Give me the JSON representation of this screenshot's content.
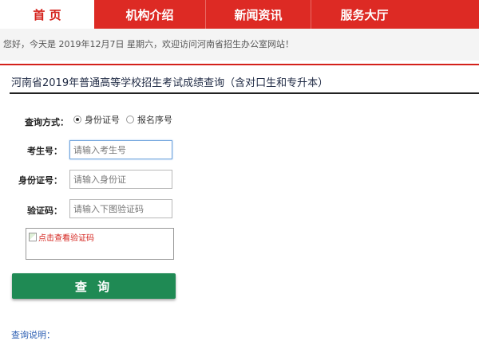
{
  "nav": {
    "tabs": [
      {
        "label": "首 页",
        "active": true
      },
      {
        "label": "机构介绍",
        "active": false
      },
      {
        "label": "新闻资讯",
        "active": false
      },
      {
        "label": "服务大厅",
        "active": false
      }
    ]
  },
  "welcome_text": "您好，今天是 2019年12月7日 星期六，欢迎访问河南省招生办公室网站！",
  "page_title": "河南省2019年普通高等学校招生考试成绩查询（含对口生和专升本）",
  "form": {
    "query_method_label": "查询方式：",
    "radio_options": [
      {
        "label": "身份证号",
        "checked": true
      },
      {
        "label": "报名序号",
        "checked": false
      }
    ],
    "exam_no_label": "考生号：",
    "exam_no_placeholder": "请输入考生号",
    "id_label": "身份证号：",
    "id_placeholder": "请输入身份证",
    "captcha_label": "验证码：",
    "captcha_placeholder": "请输入下图验证码",
    "captcha_image_alt": "点击查看验证码",
    "submit_label": "查 询"
  },
  "note_label": "查询说明：",
  "colors": {
    "nav_red": "#dd2a24",
    "button_green": "#1f8a54",
    "link_blue": "#2d5fb3"
  }
}
